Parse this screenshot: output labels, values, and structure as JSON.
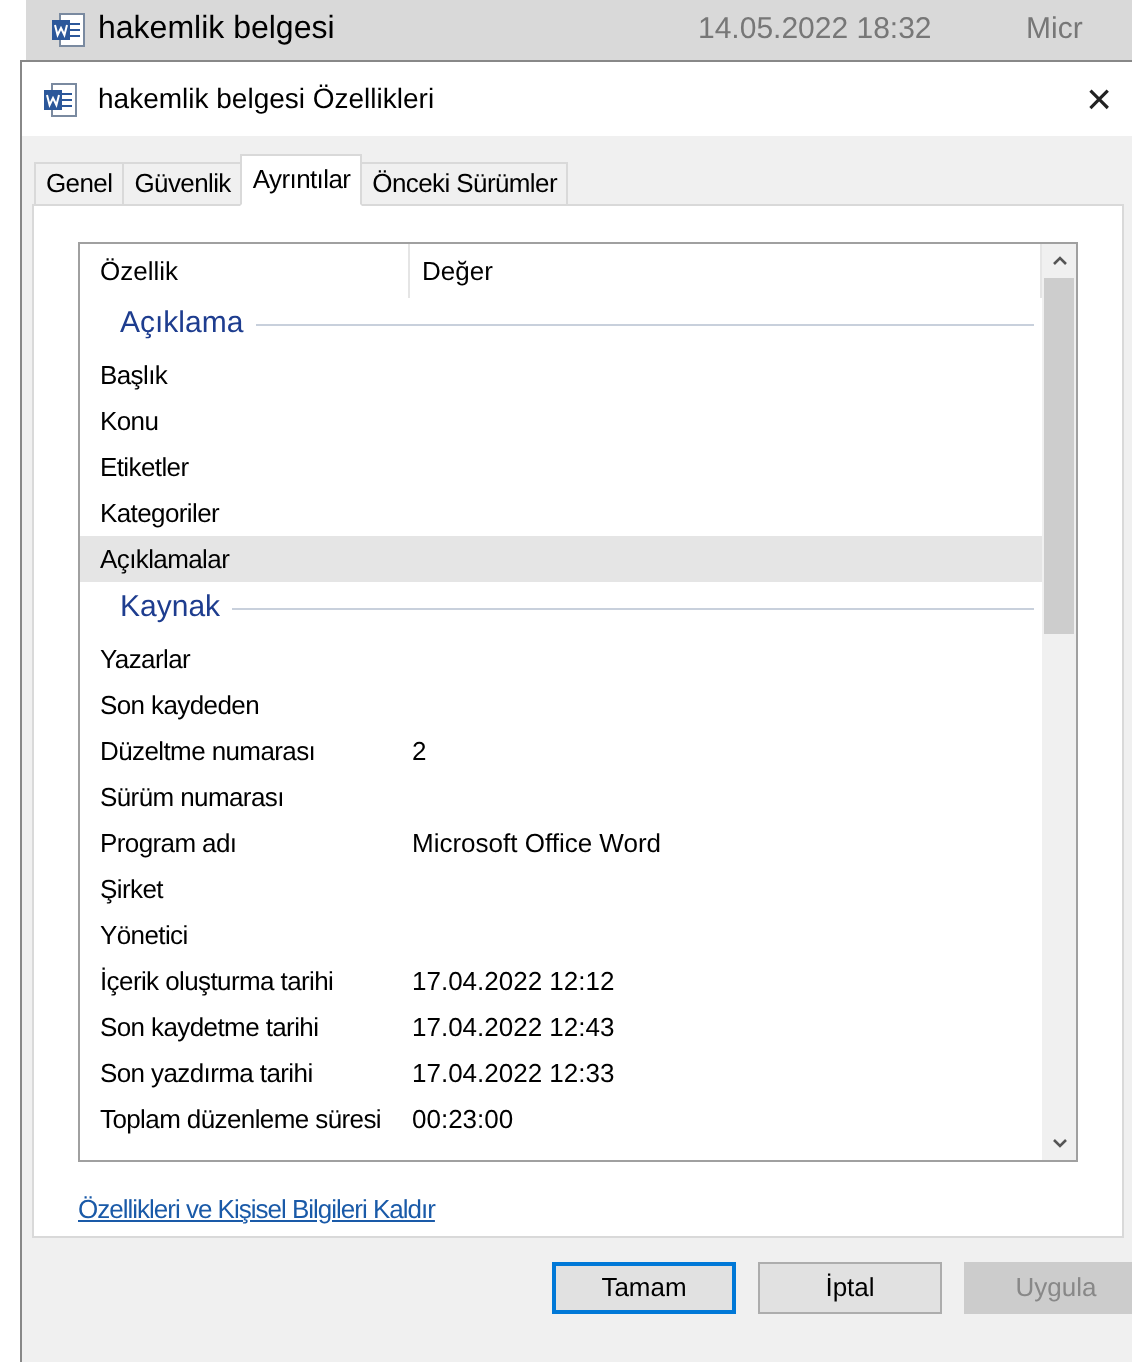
{
  "background_row": {
    "name": "hakemlik belgesi",
    "date": "14.05.2022 18:32",
    "column_3": "Micr"
  },
  "window": {
    "title": "hakemlik belgesi Özellikleri",
    "close": "×"
  },
  "tabs": [
    {
      "label": "Genel",
      "selected": false
    },
    {
      "label": "Güvenlik",
      "selected": false
    },
    {
      "label": "Ayrıntılar",
      "selected": true
    },
    {
      "label": "Önceki Sürümler",
      "selected": false
    }
  ],
  "table": {
    "columns": [
      "Özellik",
      "Değer"
    ],
    "rows": [
      {
        "kind": "group",
        "name": "Açıklama"
      },
      {
        "kind": "property",
        "name": "Başlık",
        "selected": false
      },
      {
        "kind": "property",
        "name": "Konu",
        "selected": false
      },
      {
        "kind": "property",
        "name": "Etiketler",
        "selected": false
      },
      {
        "kind": "property",
        "name": "Kategoriler",
        "selected": false
      },
      {
        "kind": "property",
        "name": "Açıklamalar",
        "selected": true
      },
      {
        "kind": "group",
        "name": "Kaynak"
      },
      {
        "kind": "property",
        "name": "Yazarlar",
        "selected": false
      },
      {
        "kind": "property",
        "name": "Son kaydeden",
        "selected": false
      },
      {
        "kind": "property",
        "name": "Düzeltme numarası",
        "value": "2",
        "selected": false
      },
      {
        "kind": "property",
        "name": "Sürüm numarası",
        "selected": false
      },
      {
        "kind": "property",
        "name": "Program adı",
        "value": "Microsoft Office Word",
        "selected": false
      },
      {
        "kind": "property",
        "name": "Şirket",
        "selected": false
      },
      {
        "kind": "property",
        "name": "Yönetici",
        "selected": false
      },
      {
        "kind": "property",
        "name": "İçerik oluşturma tarihi",
        "value": "17.04.2022 12:12",
        "selected": false
      },
      {
        "kind": "property",
        "name": "Son kaydetme tarihi",
        "value": "17.04.2022 12:43",
        "selected": false
      },
      {
        "kind": "property",
        "name": "Son yazdırma tarihi",
        "value": "17.04.2022 12:33",
        "selected": false
      },
      {
        "kind": "property",
        "name": "Toplam düzenleme süresi",
        "value": "00:23:00",
        "selected": false
      }
    ]
  },
  "link": "Özellikleri ve Kişisel Bilgileri Kaldır",
  "buttons": [
    {
      "label": "Tamam",
      "default": true,
      "disabled": false
    },
    {
      "label": "İptal",
      "default": false,
      "disabled": false
    },
    {
      "label": "Uygula",
      "default": false,
      "disabled": true
    }
  ]
}
